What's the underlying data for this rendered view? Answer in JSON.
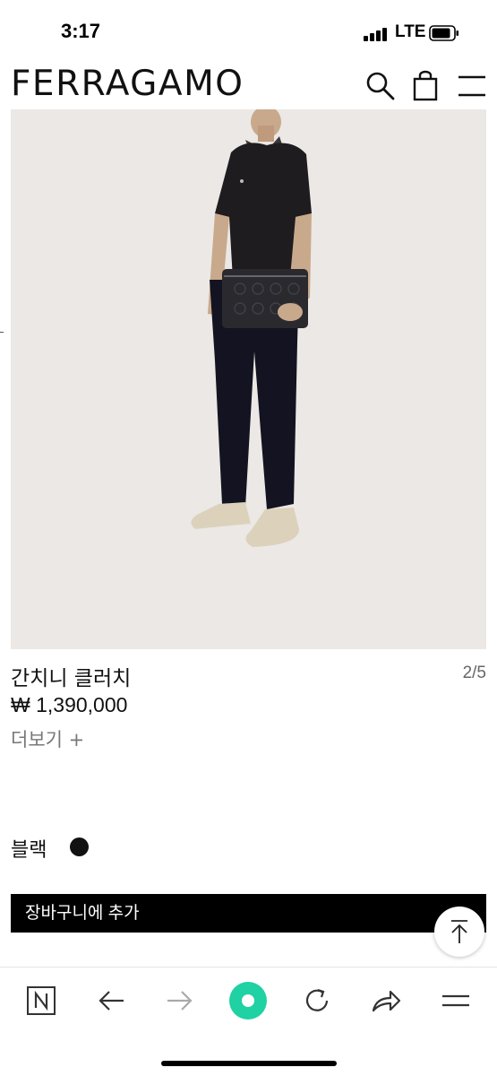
{
  "status_bar": {
    "time": "3:17",
    "network": "LTE"
  },
  "header": {
    "logo": "FERRAGAMO",
    "icons": [
      "search-icon",
      "shopping-bag-icon",
      "menu-icon"
    ]
  },
  "product": {
    "name": "간치니 클러치",
    "price": "₩ 1,390,000",
    "more_label": "더보기 +",
    "pager": "2/5",
    "color_label": "블랙",
    "color_hex": "#111111",
    "add_to_cart_label": "장바구니에 추가"
  },
  "browser_toolbar": {
    "buttons": [
      "naver-n-icon",
      "back-arrow-icon",
      "forward-arrow-icon",
      "green-dot-icon",
      "reload-icon",
      "share-icon",
      "menu-icon"
    ],
    "accent": "#1fd1a3"
  },
  "colors": {
    "hero_bg": "#ebe8e5",
    "button_bg": "#000000"
  }
}
